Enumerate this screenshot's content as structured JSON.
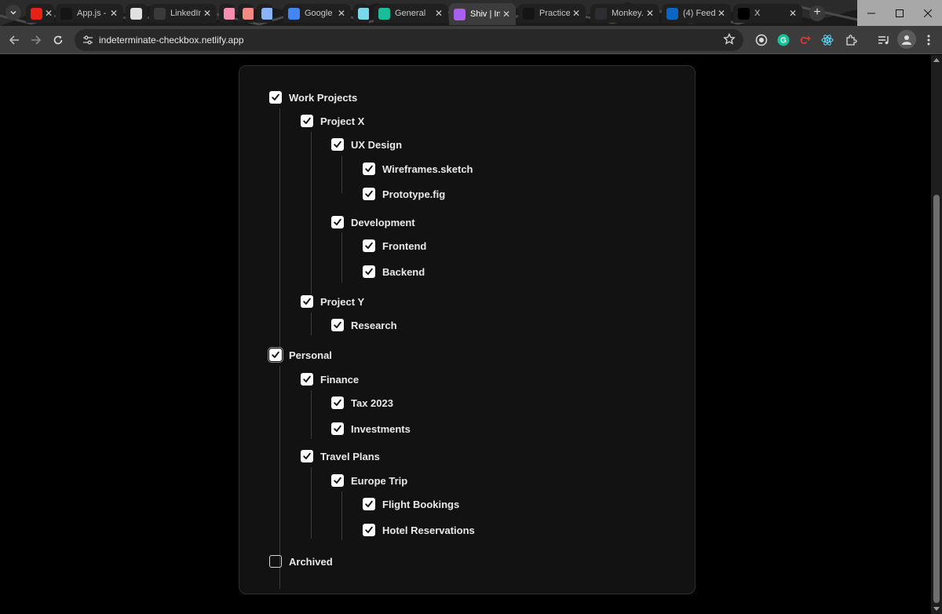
{
  "browser": {
    "tabs": [
      {
        "title": "",
        "favicon": "youtube-icon",
        "color": "#e62117"
      },
      {
        "title": "App.js - ...",
        "favicon": "codesandbox-icon",
        "color": "#151515"
      },
      {
        "title": "",
        "favicon": "blank-page-icon",
        "color": "#e0e0e0"
      },
      {
        "title": "LinkedIn",
        "favicon": "chatgpt-icon",
        "color": "#3a3a3a"
      },
      {
        "title": "",
        "favicon": "pink-app-icon",
        "color": "#f48fb1"
      },
      {
        "title": "",
        "favicon": "salmon-app-icon",
        "color": "#f28b82"
      },
      {
        "title": "",
        "favicon": "blue-app-icon",
        "color": "#8ab4f8"
      },
      {
        "title": "Google",
        "favicon": "google-icon",
        "color": "#4285f4"
      },
      {
        "title": "",
        "favicon": "cyan-app-icon",
        "color": "#78d9e8"
      },
      {
        "title": "General",
        "favicon": "diamond-icon",
        "color": "#1abc9c"
      },
      {
        "title": "Shiv | Int...",
        "favicon": "vite-icon",
        "color": "#a960ee",
        "active": true
      },
      {
        "title": "Practice",
        "favicon": "github-icon",
        "color": "#151515"
      },
      {
        "title": "Monkey...",
        "favicon": "monkeytype-icon",
        "color": "#2c2e31"
      },
      {
        "title": "(4) Feed",
        "favicon": "linkedin-icon",
        "color": "#0a66c2"
      },
      {
        "title": "X",
        "favicon": "x-icon",
        "color": "#000000"
      }
    ],
    "url": "indeterminate-checkbox.netlify.app"
  },
  "tree": [
    {
      "label": "Work Projects",
      "checked": true
    },
    {
      "label": "Project X",
      "checked": true
    },
    {
      "label": "UX Design",
      "checked": true
    },
    {
      "label": "Wireframes.sketch",
      "checked": true
    },
    {
      "label": "Prototype.fig",
      "checked": true
    },
    {
      "label": "Development",
      "checked": true
    },
    {
      "label": "Frontend",
      "checked": true
    },
    {
      "label": "Backend",
      "checked": true
    },
    {
      "label": "Project Y",
      "checked": true
    },
    {
      "label": "Research",
      "checked": true
    },
    {
      "label": "Personal",
      "checked": true
    },
    {
      "label": "Finance",
      "checked": true
    },
    {
      "label": "Tax 2023",
      "checked": true
    },
    {
      "label": "Investments",
      "checked": true
    },
    {
      "label": "Travel Plans",
      "checked": true
    },
    {
      "label": "Europe Trip",
      "checked": true
    },
    {
      "label": "Flight Bookings",
      "checked": true
    },
    {
      "label": "Hotel Reservations",
      "checked": true
    },
    {
      "label": "Archived",
      "checked": false
    }
  ]
}
